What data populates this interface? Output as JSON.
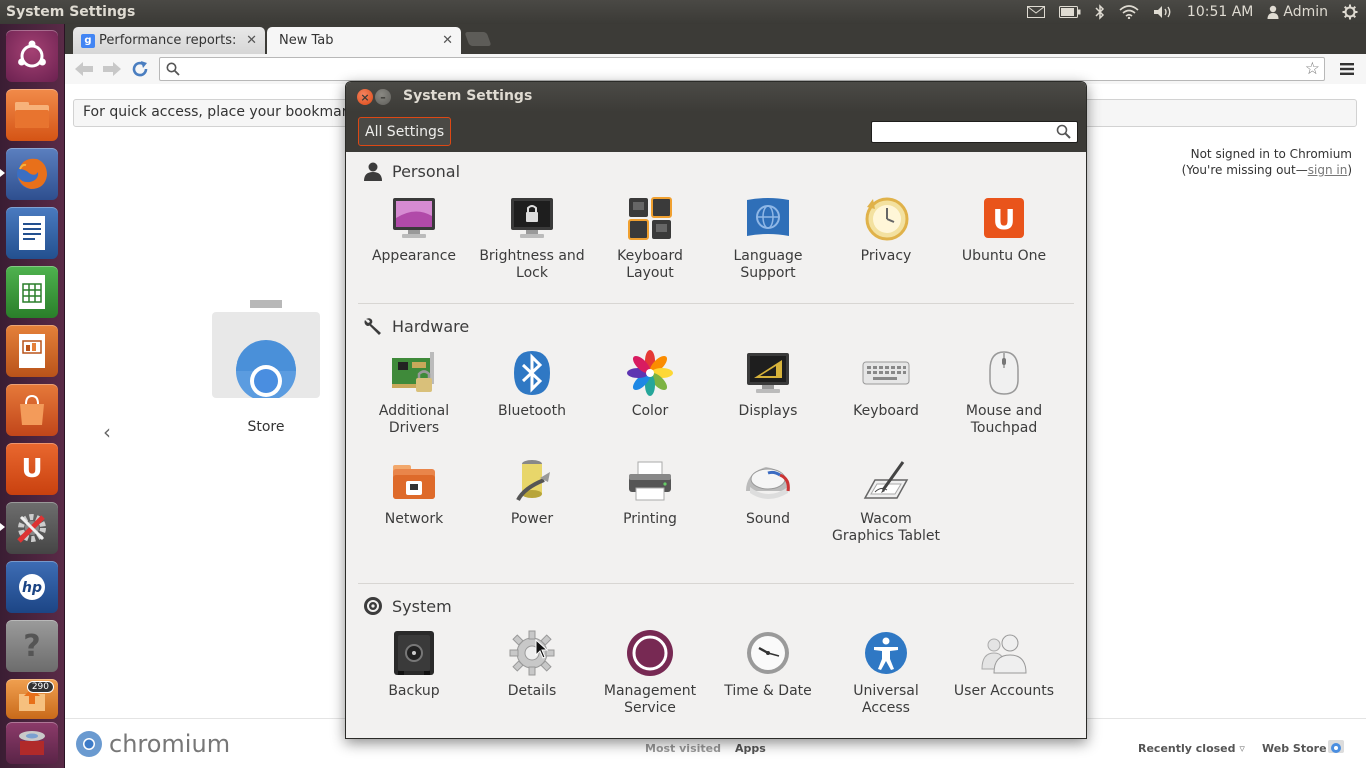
{
  "top_panel": {
    "title": "System Settings",
    "time": "10:51 AM",
    "user": "Admin",
    "icons": [
      "mail-icon",
      "battery-icon",
      "bluetooth-icon",
      "wifi-icon",
      "volume-icon",
      "user-icon",
      "session-gear-icon"
    ]
  },
  "launcher": {
    "items": [
      "dash-home",
      "files",
      "firefox",
      "libreoffice-writer",
      "libreoffice-calc",
      "libreoffice-impress",
      "ubuntu-software-center",
      "ubuntu-one",
      "system-settings",
      "hp-toolbox",
      "help",
      "update-manager"
    ],
    "update_badge": "290"
  },
  "browser": {
    "tabs": [
      {
        "label": "Performance reports: Goo",
        "favicon": "g"
      },
      {
        "label": "New Tab"
      }
    ],
    "tab_close": "✕",
    "omnibox_value": "",
    "bookmarks_hint": "For quick access, place your bookmarks",
    "signin_line1": "Not signed in to Chromium",
    "signin_line2_prefix": "(You're missing out—",
    "signin_link": "sign in",
    "signin_line2_suffix": ")",
    "store_label": "Store",
    "prev_arrow": "‹",
    "brand": "chromium",
    "footer": {
      "most_visited": "Most visited",
      "apps": "Apps",
      "recently_closed": "Recently closed",
      "web_store": "Web Store"
    }
  },
  "dialog": {
    "title": "System Settings",
    "all_settings": "All Settings",
    "search_value": "",
    "sections": {
      "personal": {
        "title": "Personal",
        "items": [
          {
            "label": "Appearance",
            "icon": "appearance-icon"
          },
          {
            "label": "Brightness and Lock",
            "icon": "brightness-lock-icon"
          },
          {
            "label": "Keyboard Layout",
            "icon": "keyboard-layout-icon"
          },
          {
            "label": "Language Support",
            "icon": "language-support-icon"
          },
          {
            "label": "Privacy",
            "icon": "privacy-icon"
          },
          {
            "label": "Ubuntu One",
            "icon": "ubuntu-one-icon"
          }
        ]
      },
      "hardware": {
        "title": "Hardware",
        "items": [
          {
            "label": "Additional Drivers",
            "icon": "additional-drivers-icon"
          },
          {
            "label": "Bluetooth",
            "icon": "bluetooth-icon"
          },
          {
            "label": "Color",
            "icon": "color-icon"
          },
          {
            "label": "Displays",
            "icon": "displays-icon"
          },
          {
            "label": "Keyboard",
            "icon": "keyboard-icon"
          },
          {
            "label": "Mouse and Touchpad",
            "icon": "mouse-icon"
          },
          {
            "label": "Network",
            "icon": "network-icon"
          },
          {
            "label": "Power",
            "icon": "power-icon"
          },
          {
            "label": "Printing",
            "icon": "printer-icon"
          },
          {
            "label": "Sound",
            "icon": "sound-icon"
          },
          {
            "label": "Wacom Graphics Tablet",
            "icon": "wacom-tablet-icon"
          }
        ]
      },
      "system": {
        "title": "System",
        "items": [
          {
            "label": "Backup",
            "icon": "backup-icon"
          },
          {
            "label": "Details",
            "icon": "details-gear-icon"
          },
          {
            "label": "Management Service",
            "icon": "management-service-icon"
          },
          {
            "label": "Time & Date",
            "icon": "clock-icon"
          },
          {
            "label": "Universal Access",
            "icon": "universal-access-icon"
          },
          {
            "label": "User Accounts",
            "icon": "user-accounts-icon"
          }
        ]
      }
    }
  },
  "colors": {
    "ubuntu_orange": "#dd4814",
    "panel_dark": "#3c3b37",
    "launcher_aubergine": "#5a2a47",
    "dialog_bg": "#f2f1f0"
  }
}
